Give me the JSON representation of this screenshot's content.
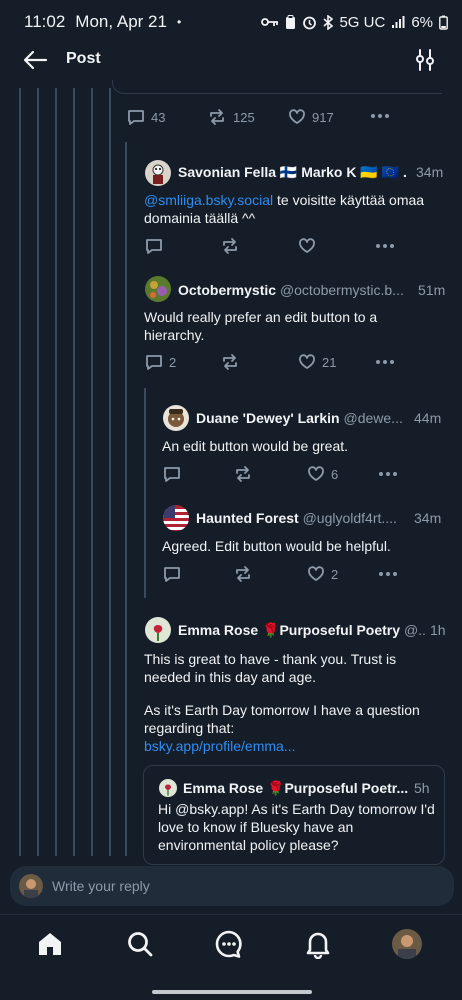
{
  "status_bar": {
    "time": "11:02",
    "date": "Mon, Apr 21",
    "dot": "•",
    "network": "5G UC",
    "battery": "6%"
  },
  "header": {
    "title": "Post",
    "back_icon": "arrow-left-icon",
    "filter_icon": "sliders-icon"
  },
  "parent_post": {
    "replies": "43",
    "reposts": "125",
    "likes": "917"
  },
  "thread": [
    {
      "name": "Savonian Fella 🇫🇮 Marko K 🇺🇦 🇪🇺 ...",
      "handle": "",
      "time": "34m",
      "text_link": "@smliiga.bsky.social",
      "text": " te voisitte käyttää omaa domainia täällä ^^",
      "replies": "",
      "likes": ""
    },
    {
      "name": "Octobermystic",
      "handle": "@octobermystic.b...",
      "time": "51m",
      "text": "Would really prefer an edit button to a hierarchy.",
      "replies": "2",
      "likes": "21"
    },
    {
      "name": "Duane 'Dewey' Larkin",
      "handle": "@dewe...",
      "time": "44m",
      "text": "An edit button would be great.",
      "replies": "",
      "likes": "6"
    },
    {
      "name": "Haunted Forest",
      "handle": "@uglyoldf4rt....",
      "time": "34m",
      "text": "Agreed. Edit button would be helpful.",
      "replies": "",
      "likes": "2"
    },
    {
      "name": "Emma Rose 🌹Purposeful Poetry",
      "handle": "@...",
      "time": "1h",
      "text1": "This is great to have - thank you. Trust is needed in this day and age.",
      "text2": "As it's Earth Day tomorrow I have a question regarding that:",
      "link": "bsky.app/profile/emma...",
      "quote": {
        "name": "Emma Rose 🌹Purposeful Poetr...",
        "time": "5h",
        "text": "Hi @bsky.app! As it's Earth Day tomorrow I'd love to know if Bluesky have an environmental policy please?"
      }
    }
  ],
  "composer": {
    "placeholder": "Write your reply"
  },
  "tabs": [
    "home-icon",
    "search-icon",
    "chat-icon",
    "bell-icon",
    "profile-avatar"
  ],
  "colors": {
    "background": "#151d28",
    "link": "#2f8df3",
    "muted": "#8c9aa9",
    "thread_line": "#3a4a5c"
  }
}
